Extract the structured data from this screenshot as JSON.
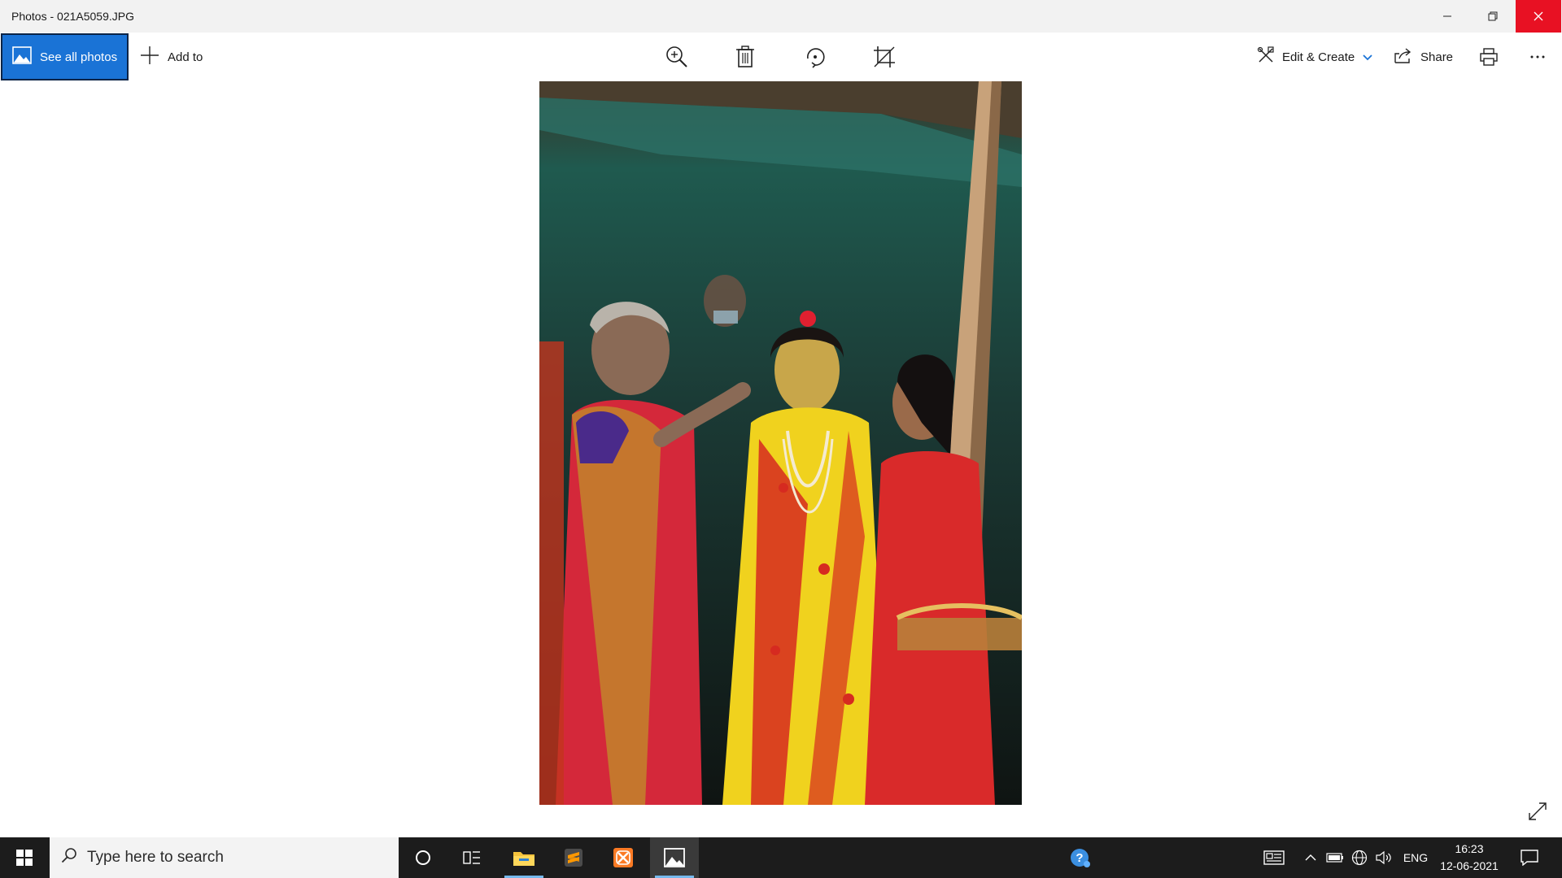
{
  "window": {
    "title": "Photos - 021A5059.JPG"
  },
  "icons": {
    "minimize": "minimize-icon",
    "maximize": "restore-icon",
    "close": "close-icon",
    "see_all": "mountain-photo-icon",
    "add": "plus-icon",
    "zoom": "zoom-in-icon",
    "delete": "trash-icon",
    "rotate": "rotate-icon",
    "crop": "crop-icon",
    "edit": "edit-create-icon",
    "share": "share-icon",
    "print": "printer-icon",
    "more": "more-icon",
    "fullscreen": "expand-icon"
  },
  "toolbar": {
    "see_all_label": "See all photos",
    "add_to_label": "Add to",
    "edit_create_label": "Edit & Create",
    "share_label": "Share"
  },
  "taskbar": {
    "search_placeholder": "Type here to search",
    "lang": "ENG",
    "time": "16:23",
    "date": "12-06-2021",
    "apps": [
      "windows-start",
      "cortana",
      "task-view",
      "file-explorer",
      "sublime-text",
      "xampp",
      "photos"
    ]
  },
  "colors": {
    "accent": "#1a73d6",
    "close_red": "#e81123",
    "taskbar": "#1c1c1c",
    "active_underline": "#76b9ed"
  }
}
